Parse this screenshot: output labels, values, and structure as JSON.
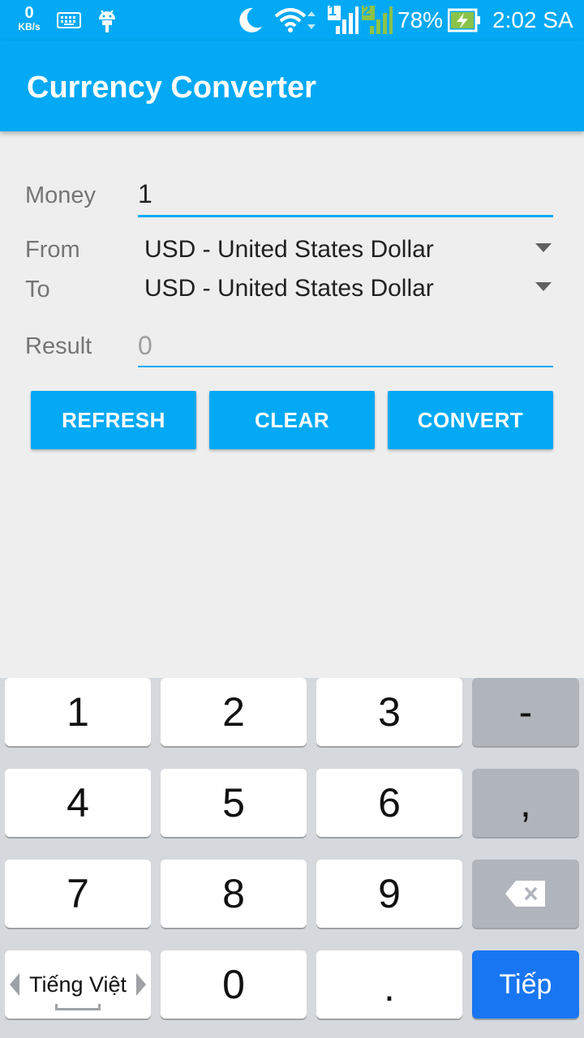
{
  "status_bar": {
    "net_speed": "0",
    "net_unit": "KB/s",
    "sim1": "1",
    "sim2": "2",
    "battery": "78%",
    "time": "2:02 SA",
    "icons": [
      "keyboard-icon",
      "android-icon",
      "moon-icon",
      "wifi-icon",
      "signal-icon",
      "battery-charging-icon"
    ]
  },
  "app_bar": {
    "title": "Currency Converter"
  },
  "form": {
    "money_label": "Money",
    "money_value": "1",
    "from_label": "From",
    "from_value": "USD - United States Dollar",
    "to_label": "To",
    "to_value": "USD - United States Dollar",
    "result_label": "Result",
    "result_value": "0"
  },
  "buttons": {
    "refresh": "REFRESH",
    "clear": "CLEAR",
    "convert": "CONVERT"
  },
  "keyboard": {
    "keys": [
      "1",
      "2",
      "3",
      "-",
      "4",
      "5",
      "6",
      ",",
      "7",
      "8",
      "9",
      "0",
      "."
    ],
    "language": "Tiếng Việt",
    "action": "Tiếp"
  },
  "colors": {
    "accent": "#03a9f4",
    "action_key": "#1976f2"
  }
}
